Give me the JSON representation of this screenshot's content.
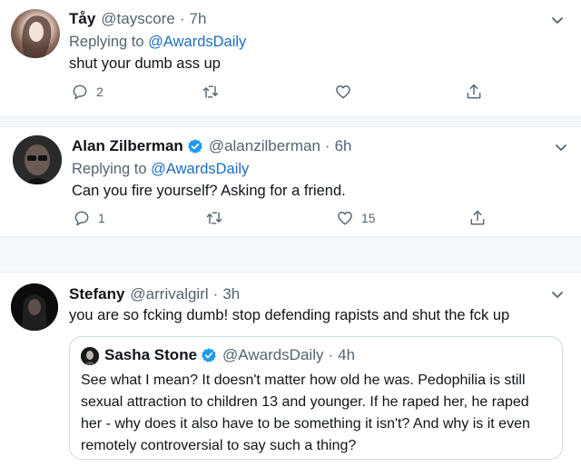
{
  "tweets": [
    {
      "name": "Tåy",
      "handle": "@tayscore",
      "time": "7h",
      "replying_label": "Replying to",
      "replying_to": "@AwardsDaily",
      "text": "shut your dumb ass up",
      "reply_count": "2",
      "retweet_count": "",
      "like_count": ""
    },
    {
      "name": "Alan Zilberman",
      "handle": "@alanzilberman",
      "time": "6h",
      "verified": true,
      "replying_label": "Replying to",
      "replying_to": "@AwardsDaily",
      "text": "Can you fire yourself? Asking for a friend.",
      "reply_count": "1",
      "retweet_count": "",
      "like_count": "15"
    },
    {
      "name": "Stefany",
      "handle": "@arrivalgirl",
      "time": "3h",
      "text": "you are so fcking dumb! stop defending rapists and shut the fck up",
      "quote": {
        "name": "Sasha Stone",
        "handle": "@AwardsDaily",
        "time": "4h",
        "verified": true,
        "text": "See what I mean? It doesn't matter how old he was. Pedophilia is still sexual attraction to children 13 and younger. If he raped her, he raped her - why does it also have to be something it isn't? And why is it even remotely controversial to say such a thing?"
      }
    }
  ],
  "separator": "·",
  "colors": {
    "accent": "#1d9bf0",
    "link": "#1b6ec2",
    "muted": "#536471",
    "border": "#e6ecf0"
  },
  "icons": [
    "chevron-down-icon",
    "reply-icon",
    "retweet-icon",
    "like-icon",
    "share-icon",
    "verified-badge-icon"
  ]
}
